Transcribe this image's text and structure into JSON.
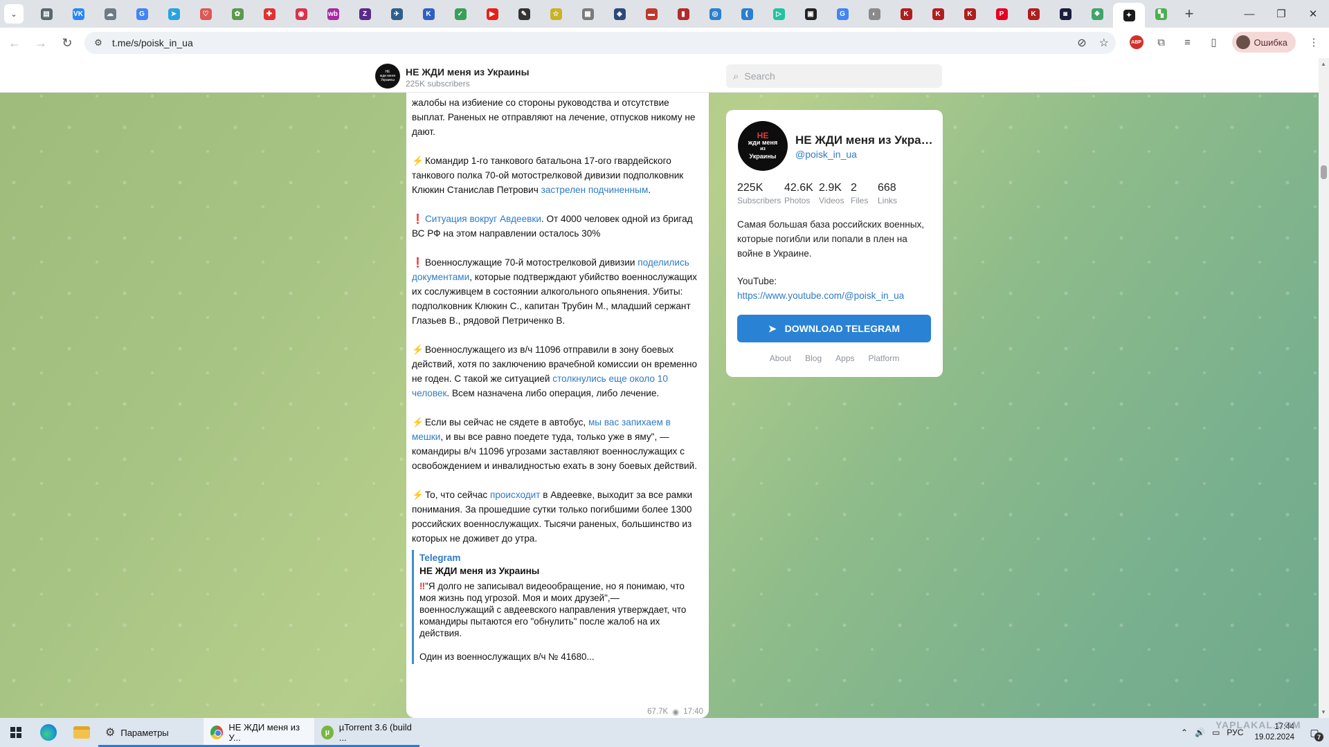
{
  "browser": {
    "tab_favicons": [
      {
        "icon": "photo-favicon",
        "color": "#5b6770",
        "glyph": "▤"
      },
      {
        "icon": "vk-favicon",
        "color": "#2787f5",
        "glyph": "VK"
      },
      {
        "icon": "cloud-favicon",
        "color": "#6d7b86",
        "glyph": "☁"
      },
      {
        "icon": "google-favicon",
        "color": "#4285f4",
        "glyph": "G"
      },
      {
        "icon": "telegram-favicon",
        "color": "#2aa3df",
        "glyph": "➤"
      },
      {
        "icon": "heart-favicon",
        "color": "#e05656",
        "glyph": "♡"
      },
      {
        "icon": "leaf-favicon",
        "color": "#5a9a4a",
        "glyph": "✿"
      },
      {
        "icon": "red-square-favicon",
        "color": "#e23030",
        "glyph": "✚"
      },
      {
        "icon": "circle-favicon",
        "color": "#d9334b",
        "glyph": "◉"
      },
      {
        "icon": "wb-favicon",
        "color": "#a72aa3",
        "glyph": "wb"
      },
      {
        "icon": "purple-favicon",
        "color": "#5b2a86",
        "glyph": "Z"
      },
      {
        "icon": "bird-favicon",
        "color": "#2d5f8a",
        "glyph": "✈"
      },
      {
        "icon": "k-favicon",
        "color": "#3060c0",
        "glyph": "K"
      },
      {
        "icon": "check-favicon",
        "color": "#37a057",
        "glyph": "✓"
      },
      {
        "icon": "youtube-favicon",
        "color": "#e62117",
        "glyph": "▶"
      },
      {
        "icon": "pen-favicon",
        "color": "#333333",
        "glyph": "✎"
      },
      {
        "icon": "star-favicon",
        "color": "#c9b227",
        "glyph": "☆"
      },
      {
        "icon": "doc-favicon",
        "color": "#7a7a7a",
        "glyph": "▦"
      },
      {
        "icon": "shield-favicon",
        "color": "#2c4a7a",
        "glyph": "◈"
      },
      {
        "icon": "flag-favicon",
        "color": "#c0392b",
        "glyph": "▬"
      },
      {
        "icon": "bars-favicon",
        "color": "#b22b2b",
        "glyph": "▮"
      },
      {
        "icon": "pill-favicon",
        "color": "#2b7fd0",
        "glyph": "◎"
      },
      {
        "icon": "bracket-favicon",
        "color": "#2b7fd0",
        "glyph": "❪"
      },
      {
        "icon": "play-favicon",
        "color": "#23c2a0",
        "glyph": "▷"
      },
      {
        "icon": "grid-favicon",
        "color": "#222222",
        "glyph": "▣"
      },
      {
        "icon": "g-favicon",
        "color": "#4285f4",
        "glyph": "G"
      },
      {
        "icon": "globe-favicon",
        "color": "#8a8a8a",
        "glyph": "◐"
      },
      {
        "icon": "kinopoisk-favicon",
        "color": "#b01e1e",
        "glyph": "K"
      },
      {
        "icon": "kinopoisk-favicon",
        "color": "#b01e1e",
        "glyph": "K"
      },
      {
        "icon": "kinopoisk-favicon",
        "color": "#b01e1e",
        "glyph": "K"
      },
      {
        "icon": "pinterest-favicon",
        "color": "#e60023",
        "glyph": "P"
      },
      {
        "icon": "kinopoisk-favicon",
        "color": "#b01e1e",
        "glyph": "K"
      },
      {
        "icon": "hd-favicon",
        "color": "#1a1f3a",
        "glyph": "◙"
      },
      {
        "icon": "apps-favicon",
        "color": "#3fa56a",
        "glyph": "❖"
      },
      {
        "icon": "telegram-active-favicon",
        "color": "#1b1b1b",
        "glyph": "✦"
      },
      {
        "icon": "tiles-favicon",
        "color": "#4caf50",
        "glyph": "▚"
      }
    ],
    "url": "t.me/s/poisk_in_ua",
    "profile_label": "Ошибка"
  },
  "tg": {
    "header": {
      "title": "НЕ ЖДИ меня из Украины",
      "subscribers": "225K subscribers",
      "search_placeholder": "Search"
    },
    "message": {
      "p1": "жалобы на избиение со стороны руководства и отсутствие выплат. Раненых не отправляют на лечение, отпусков никому не дают.",
      "p2_text": "Командир 1-го танкового батальона 17-ого гвардейского танкового полка 70-ой мотострелковой дивизии подполковник Клюкин Станислав Петрович ",
      "p2_link": "застрелен подчиненным",
      "p2_end": ".",
      "p3_link": "Ситуация вокруг Авдеевки",
      "p3_text": ". От 4000 человек одной из бригад ВС РФ на этом направлении осталось 30%",
      "p4_text": "Военнослужащие 70-й мотострелковой дивизии ",
      "p4_link": "поделились документами",
      "p4_end": ", которые подтверждают убийство военнослужащих их сослуживцем в состоянии алкогольного опьянения. Убиты: подполковник Клюкин С., капитан Трубин М., младший сержант Глазьев В., рядовой Петриченко В.",
      "p5_text": "Военнослужащего из в/ч 11096 отправили в зону боевых действий, хотя по заключению врачебной комиссии он временно не годен. С такой же ситуацией ",
      "p5_link": "столкнулись еще около 10 человек",
      "p5_end": ". Всем назначена либо операция, либо лечение.",
      "p6_text": "Если вы сейчас не сядете в автобус, ",
      "p6_link": "мы вас запихаем в мешки",
      "p6_end": ", и вы все равно поедете туда, только уже в яму\", — командиры в/ч 11096 угрозами заставляют военнослужащих с освобождением и инвалидностью ехать в зону боевых действий.",
      "p7_text": "То, что сейчас ",
      "p7_link": "происходит",
      "p7_end": " в Авдеевке, выходит за все рамки понимания. За прошедшие сутки только погибшими более 1300 российских военнослужащих. Тысячи раненых, большинство из которых не доживет до утра.",
      "quote_source": "Telegram",
      "quote_title": "НЕ ЖДИ меня из Украины",
      "quote_text": "\"Я долго не записывал видеообращение, но я понимаю, что моя жизнь под угрозой. Моя и моих друзей\",— военнослужащий с авдеевского направления утверждает, что командиры пытаются его \"обнулить\" после жалоб на их действия.",
      "quote_more": "Один из военнослужащих в/ч № 41680...",
      "views": "67.7K",
      "time": "17:40"
    },
    "card": {
      "avatar_top": "НЕ",
      "avatar_mid": "жди меня",
      "avatar_small": "из",
      "avatar_bottom": "Украины",
      "name": "НЕ ЖДИ меня из Украины",
      "handle": "@poisk_in_ua",
      "stats": [
        {
          "value": "225K",
          "label": "Subscribers"
        },
        {
          "value": "42.6K",
          "label": "Photos"
        },
        {
          "value": "2.9K",
          "label": "Videos"
        },
        {
          "value": "2",
          "label": "Files"
        },
        {
          "value": "668",
          "label": "Links"
        }
      ],
      "description": "Самая большая база российских военных, которые погибли или попали в плен на войне в Украине.",
      "youtube_label": "YouTube:",
      "youtube_link": "https://www.youtube.com/@poisk_in_ua",
      "download_label": "DOWNLOAD TELEGRAM",
      "links": [
        "About",
        "Blog",
        "Apps",
        "Platform"
      ]
    }
  },
  "taskbar": {
    "tasks": [
      {
        "label": "Параметры"
      },
      {
        "label": "НЕ ЖДИ меня из У..."
      },
      {
        "label": "µTorrent 3.6  (build ..."
      }
    ],
    "lang": "РУС",
    "time": "17:44",
    "date": "19.02.2024",
    "notif_count": "7",
    "watermark": "YAPLAKAL.COM"
  },
  "colors": {
    "link": "#2e7bc6",
    "button": "#2a82d4",
    "accent_bar": "#2a7ad3"
  }
}
